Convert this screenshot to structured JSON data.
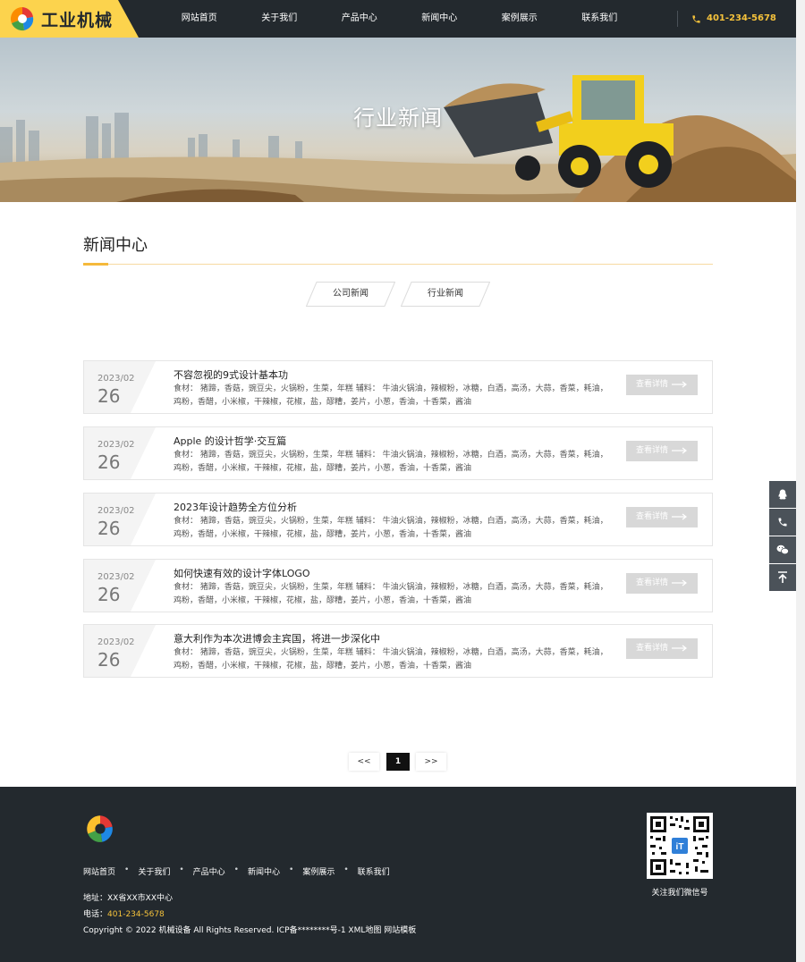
{
  "header": {
    "logo_text": "工业机械",
    "nav": [
      "网站首页",
      "关于我们",
      "产品中心",
      "新闻中心",
      "案例展示",
      "联系我们"
    ],
    "phone": "401-234-5678"
  },
  "banner": {
    "title": "行业新闻"
  },
  "section": {
    "title": "新闻中心",
    "tabs": [
      "公司新闻",
      "行业新闻"
    ]
  },
  "news": [
    {
      "date_ym": "2023/02",
      "date_d": "26",
      "title": "不容忽视的9式设计基本功",
      "desc": "食材：          猪蹄，香菇，豌豆尖，火锅粉，生菜，年糕          辅料：          牛油火锅油，辣椒粉，冰糖，白酒，高汤，大蒜，香菜，耗油，鸡粉，香醋，小米椒，干辣椒，花椒，盐，醪糟，姜片，小葱，香油，十香菜，酱油",
      "button": "查看详情"
    },
    {
      "date_ym": "2023/02",
      "date_d": "26",
      "title": "Apple 的设计哲学·交互篇",
      "desc": "食材：          猪蹄，香菇，豌豆尖，火锅粉，生菜，年糕          辅料：          牛油火锅油，辣椒粉，冰糖，白酒，高汤，大蒜，香菜，耗油，鸡粉，香醋，小米椒，干辣椒，花椒，盐，醪糟，姜片，小葱，香油，十香菜，酱油",
      "button": "查看详情"
    },
    {
      "date_ym": "2023/02",
      "date_d": "26",
      "title": "2023年设计趋势全方位分析",
      "desc": "食材：          猪蹄，香菇，豌豆尖，火锅粉，生菜，年糕          辅料：          牛油火锅油，辣椒粉，冰糖，白酒，高汤，大蒜，香菜，耗油，鸡粉，香醋，小米椒，干辣椒，花椒，盐，醪糟，姜片，小葱，香油，十香菜，酱油",
      "button": "查看详情"
    },
    {
      "date_ym": "2023/02",
      "date_d": "26",
      "title": "如何快速有效的设计字体LOGO",
      "desc": "食材：          猪蹄，香菇，豌豆尖，火锅粉，生菜，年糕          辅料：          牛油火锅油，辣椒粉，冰糖，白酒，高汤，大蒜，香菜，耗油，鸡粉，香醋，小米椒，干辣椒，花椒，盐，醪糟，姜片，小葱，香油，十香菜，酱油",
      "button": "查看详情"
    },
    {
      "date_ym": "2023/02",
      "date_d": "26",
      "title": "意大利作为本次进博会主宾国，将进一步深化中",
      "desc": "食材：          猪蹄，香菇，豌豆尖，火锅粉，生菜，年糕          辅料：          牛油火锅油，辣椒粉，冰糖，白酒，高汤，大蒜，香菜，耗油，鸡粉，香醋，小米椒，干辣椒，花椒，盐，醪糟，姜片，小葱，香油，十香菜，酱油",
      "button": "查看详情"
    }
  ],
  "pagination": {
    "prev": "<<",
    "current": "1",
    "next": ">>"
  },
  "side_tools": [
    "qq-icon",
    "phone-icon",
    "wechat-icon",
    "back-to-top-icon"
  ],
  "footer": {
    "nav": [
      "网站首页",
      "关于我们",
      "产品中心",
      "新闻中心",
      "案例展示",
      "联系我们"
    ],
    "address": "地址：XX省XX市XX中心",
    "tel_label": "电话：",
    "tel": "401-234-5678",
    "copyright": "Copyright © 2022 机械设备 All Rights Reserved. ICP备********号-1 XML地图 网站模板",
    "qr_caption": "关注我们微信号"
  },
  "colors": {
    "accent": "#f5c23b",
    "dark": "#23292e",
    "logo_bg": "#fcd34d"
  }
}
